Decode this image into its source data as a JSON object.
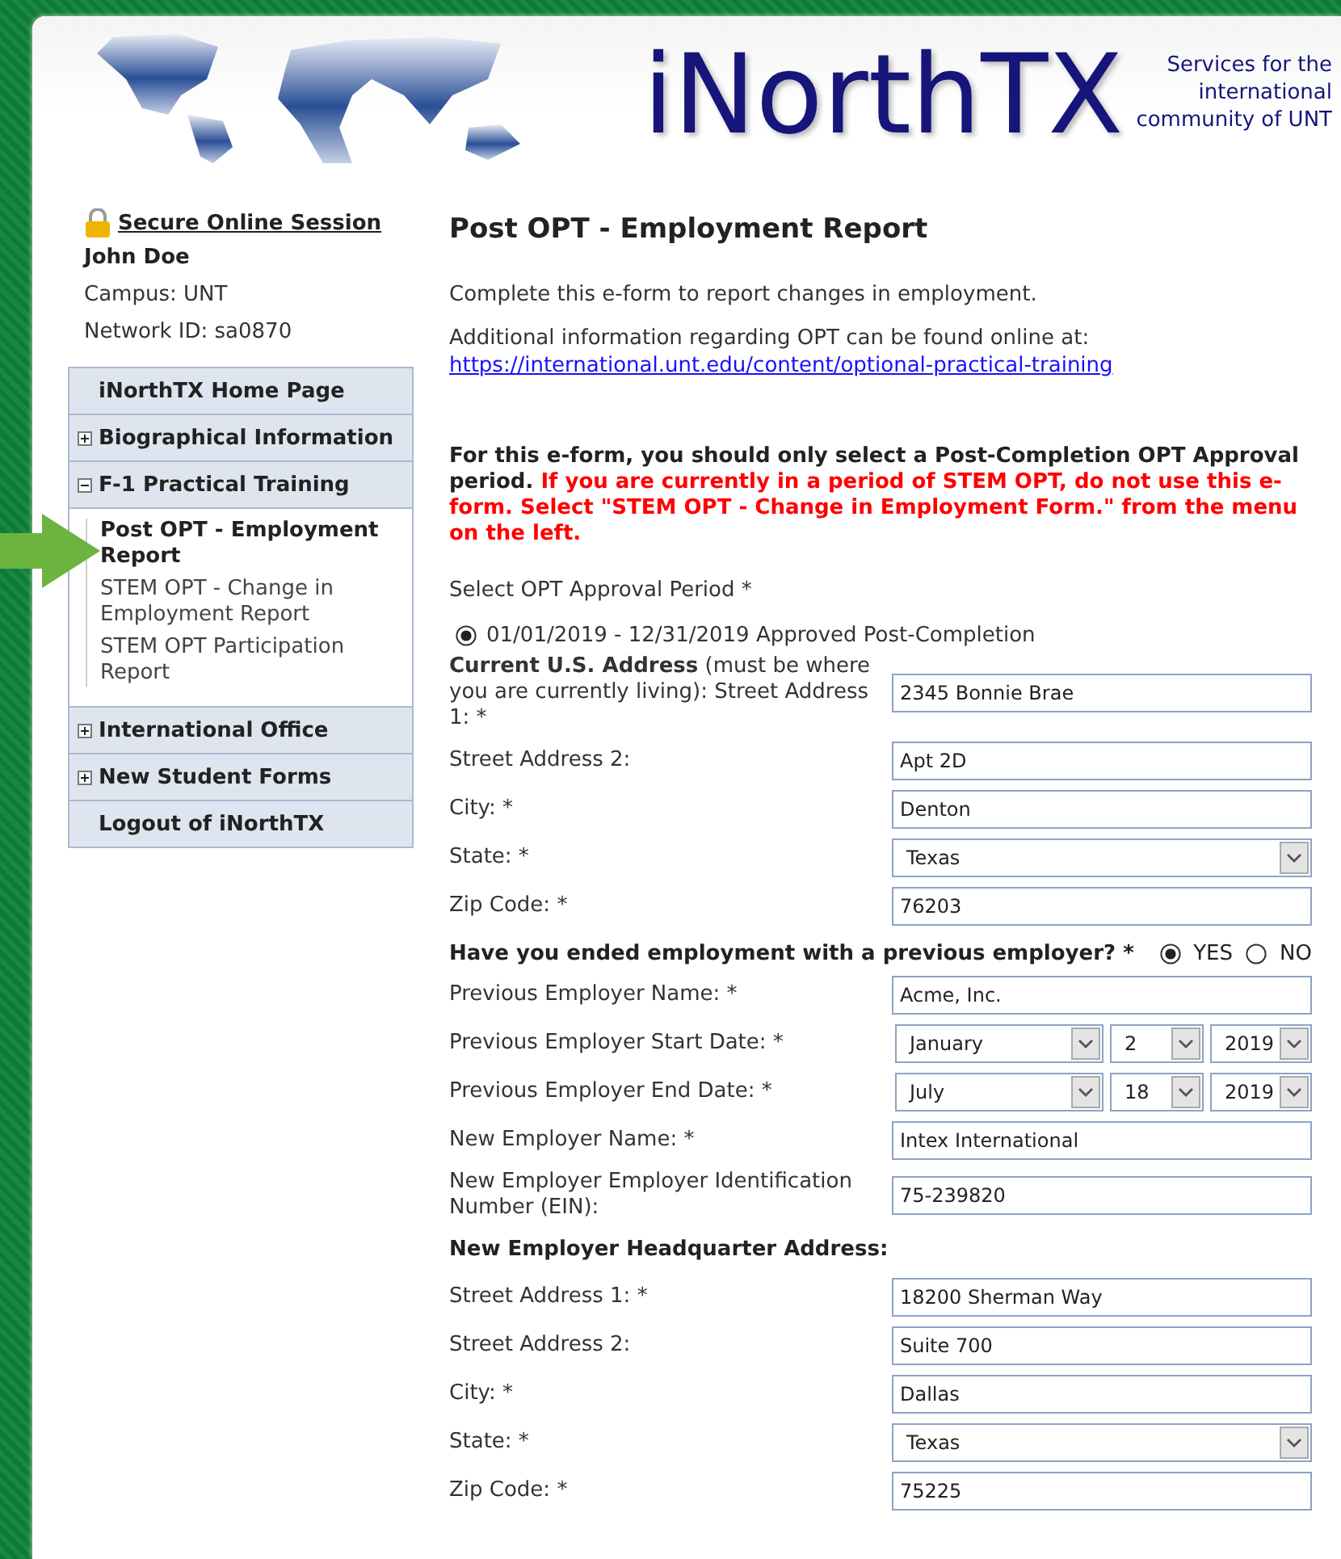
{
  "header": {
    "title": "iNorthTX",
    "tagline": [
      "Services for the",
      "international",
      "community of UNT"
    ]
  },
  "session": {
    "label": "Secure Online Session",
    "user": "John Doe",
    "campus": "Campus: UNT",
    "network_id": "Network ID: sa0870"
  },
  "nav": {
    "items": [
      {
        "kind": "link",
        "label": "iNorthTX Home Page"
      },
      {
        "kind": "section",
        "label": "Biographical Information",
        "expanded": false
      },
      {
        "kind": "section",
        "label": "F-1 Practical Training",
        "expanded": true,
        "children": [
          {
            "label": "Post OPT - Employment Report",
            "selected": true
          },
          {
            "label": "STEM OPT - Change in Employment Report",
            "selected": false
          },
          {
            "label": "STEM OPT Participation Report",
            "selected": false
          }
        ]
      },
      {
        "kind": "section",
        "label": "International Office",
        "expanded": false
      },
      {
        "kind": "section",
        "label": "New Student Forms",
        "expanded": false
      },
      {
        "kind": "link",
        "label": "Logout of iNorthTX"
      }
    ]
  },
  "form": {
    "title": "Post OPT - Employment Report",
    "intro": "Complete this e-form to report changes in employment.",
    "info_text": "Additional information regarding OPT can be found online at:",
    "info_link": "https://international.unt.edu/content/optional-practical-training",
    "notice": "For this e-form, you should only select a Post-Completion OPT Approval period.",
    "warning": "If you are currently in a period of STEM OPT, do not use this e-form. Select \"STEM OPT - Change in Employment Form.\" from the menu on the left.",
    "period_label": "Select OPT Approval Period *",
    "period_options": [
      {
        "label": "01/01/2019 - 12/31/2019 Approved Post-Completion",
        "selected": true
      }
    ],
    "rows": [
      {
        "kind": "text",
        "label": "**Current U.S. Address** (must be where you are currently living): Street Address 1:  *",
        "value": "2345 Bonnie Brae"
      },
      {
        "kind": "text",
        "label": "Street Address 2:",
        "value": "Apt 2D"
      },
      {
        "kind": "text",
        "label": "City: *",
        "value": "Denton"
      },
      {
        "kind": "select",
        "label": "State: *",
        "value": "Texas"
      },
      {
        "kind": "text",
        "label": "Zip Code: *",
        "value": "76203"
      },
      {
        "kind": "question",
        "label": "Have you ended employment with a previous employer?",
        "required": "*",
        "options": [
          {
            "label": "YES",
            "selected": true
          },
          {
            "label": "NO",
            "selected": false
          }
        ]
      },
      {
        "kind": "text",
        "label": "Previous Employer Name: *",
        "value": "Acme, Inc."
      },
      {
        "kind": "date",
        "label": "Previous Employer Start Date: *",
        "month": "January",
        "day": "2",
        "year": "2019"
      },
      {
        "kind": "date",
        "label": "Previous Employer End Date: *",
        "month": "July",
        "day": "18",
        "year": "2019"
      },
      {
        "kind": "text",
        "label": "New Employer Name:  *",
        "value": "Intex International"
      },
      {
        "kind": "text",
        "label": "New Employer Employer Identification Number (EIN):",
        "value": "75-239820"
      },
      {
        "kind": "heading",
        "label": "New Employer Headquarter Address:"
      },
      {
        "kind": "text",
        "label": "Street Address 1: *",
        "value": "18200 Sherman Way"
      },
      {
        "kind": "text",
        "label": "Street Address 2:",
        "value": "Suite 700"
      },
      {
        "kind": "text",
        "label": "City: *",
        "value": "Dallas"
      },
      {
        "kind": "select",
        "label": "State: *",
        "value": "Texas"
      },
      {
        "kind": "text",
        "label": "Zip Code: *",
        "value": "75225"
      }
    ]
  }
}
